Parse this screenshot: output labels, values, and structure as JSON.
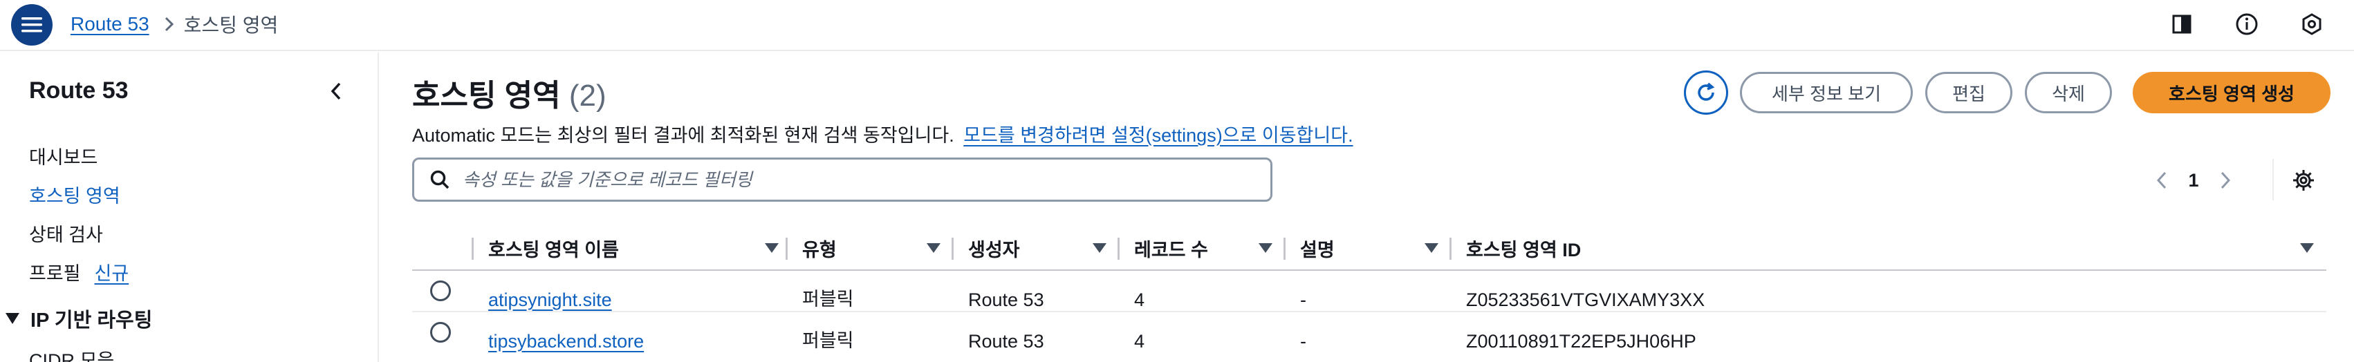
{
  "header": {
    "breadcrumb": {
      "root": "Route 53",
      "current": "호스팅 영역"
    }
  },
  "sidebar": {
    "title": "Route 53",
    "items": [
      {
        "label": "대시보드"
      },
      {
        "label": "호스팅 영역"
      },
      {
        "label": "상태 검사"
      },
      {
        "label": "프로필",
        "badge": "신규"
      }
    ],
    "section": {
      "label": "IP 기반 라우팅"
    },
    "section_items": [
      {
        "label": "CIDR 모음"
      }
    ]
  },
  "main": {
    "title": "호스팅 영역",
    "count": "(2)",
    "mode_text": "Automatic 모드는 최상의 필터 결과에 최적화된 현재 검색 동작입니다.",
    "mode_link": "모드를 변경하려면 설정(settings)으로 이동합니다.",
    "buttons": {
      "details": "세부 정보 보기",
      "edit": "편집",
      "delete": "삭제",
      "create": "호스팅 영역 생성"
    },
    "search": {
      "placeholder": "속성 또는 값을 기준으로 레코드 필터링"
    },
    "pagination": {
      "page": "1"
    },
    "table": {
      "columns": [
        "호스팅 영역 이름",
        "유형",
        "생성자",
        "레코드 수",
        "설명",
        "호스팅 영역 ID"
      ],
      "rows": [
        {
          "name": "atipsynight.site",
          "type": "퍼블릭",
          "created_by": "Route 53",
          "records": "4",
          "description": "-",
          "id": "Z05233561VTGVIXAMY3XX"
        },
        {
          "name": "tipsybackend.store",
          "type": "퍼블릭",
          "created_by": "Route 53",
          "records": "4",
          "description": "-",
          "id": "Z00110891T22EP5JH06HP"
        }
      ]
    }
  },
  "colors": {
    "link": "#0f61c0",
    "primary": "#f0932a",
    "menu": "#0f3f86"
  }
}
